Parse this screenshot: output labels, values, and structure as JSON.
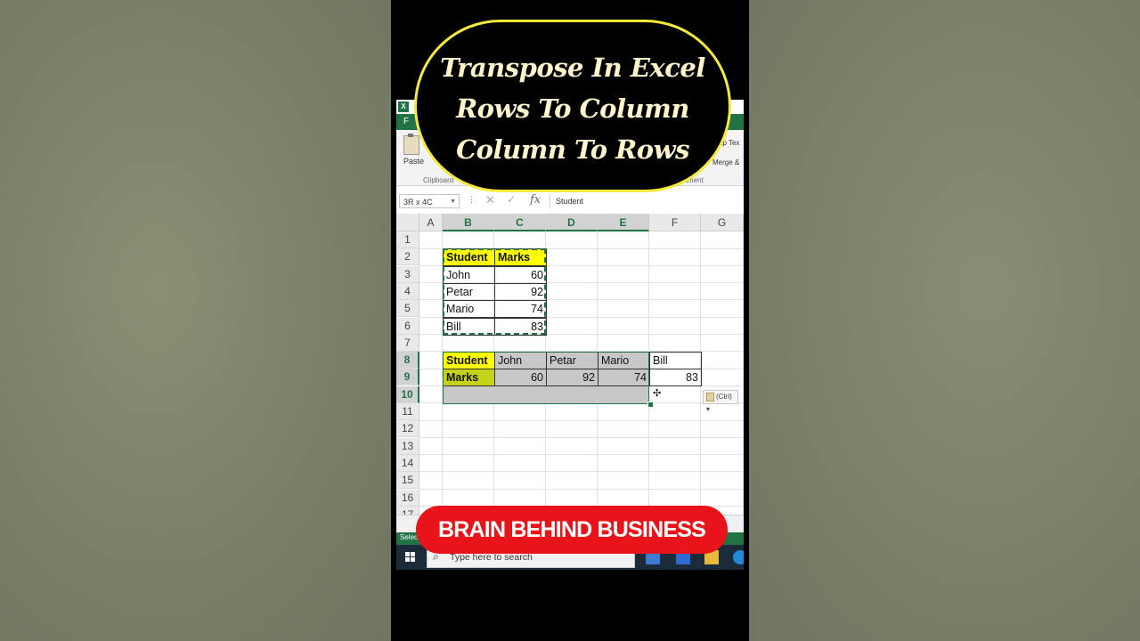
{
  "overlay": {
    "title_lines": [
      "Transpose In Excel",
      "Rows To Column",
      "Column To Rows"
    ],
    "brand": "BRAIN BEHIND BUSINESS"
  },
  "ribbon": {
    "file_tab": "F",
    "paste_label": "Paste",
    "clipboard_group": "Clipboard",
    "wrap_text": "ap Tex",
    "merge": "Merge &",
    "alignment_group": "gnment"
  },
  "formula_bar": {
    "name_box": "3R x 4C",
    "content": "Student"
  },
  "columns": [
    "A",
    "B",
    "C",
    "D",
    "E",
    "F",
    "G"
  ],
  "rows": [
    "1",
    "2",
    "3",
    "4",
    "5",
    "6",
    "7",
    "8",
    "9",
    "10",
    "11",
    "12",
    "13",
    "14",
    "15",
    "16",
    "17"
  ],
  "source_table": {
    "headers": [
      "Student",
      "Marks"
    ],
    "rows": [
      {
        "name": "John",
        "mark": "60"
      },
      {
        "name": "Petar",
        "mark": "92"
      },
      {
        "name": "Mario",
        "mark": "74"
      },
      {
        "name": "Bill",
        "mark": "83"
      }
    ]
  },
  "transposed_table": {
    "row1": [
      "Student",
      "John",
      "Petar",
      "Mario",
      "Bill"
    ],
    "row2": [
      "Marks",
      "60",
      "92",
      "74",
      "83"
    ]
  },
  "paste_options": "(Ctrl)",
  "status": "Selec",
  "taskbar": {
    "search_placeholder": "Type here to search"
  }
}
